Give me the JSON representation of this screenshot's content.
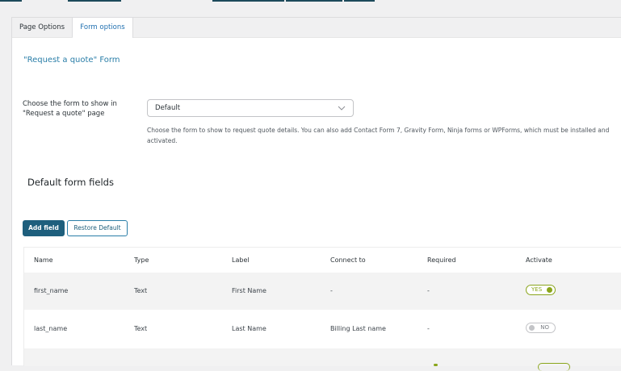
{
  "tabs": [
    {
      "label": "Page Options"
    },
    {
      "label": "Form options"
    }
  ],
  "form_title": "\"Request a quote\" Form",
  "form_select": {
    "label": "Choose the form to show in \"Request a quote\" page",
    "value": "Default",
    "help": "Choose the form to show to request quote details. You can also add Contact Form 7, Gravity Form, Ninja forms or WPForms, which must be installed and activated."
  },
  "section_title": "Default form fields",
  "buttons": {
    "add_field": "Add field",
    "restore_default": "Restore Default"
  },
  "table": {
    "headers": {
      "name": "Name",
      "type": "Type",
      "label": "Label",
      "connect": "Connect to",
      "required": "Required",
      "activate": "Activate"
    },
    "rows": [
      {
        "name": "first_name",
        "type": "Text",
        "label": "First Name",
        "connect": "-",
        "required": "-",
        "activate": "YES"
      },
      {
        "name": "last_name",
        "type": "Text",
        "label": "Last Name",
        "connect": "Billing Last name",
        "required": "-",
        "activate": "NO"
      }
    ]
  },
  "colors": {
    "accent": "#2a7ea8",
    "primary_button": "#1e5f7d",
    "toggle_on": "#8aa51b",
    "toggle_off": "#c3c4c7"
  }
}
